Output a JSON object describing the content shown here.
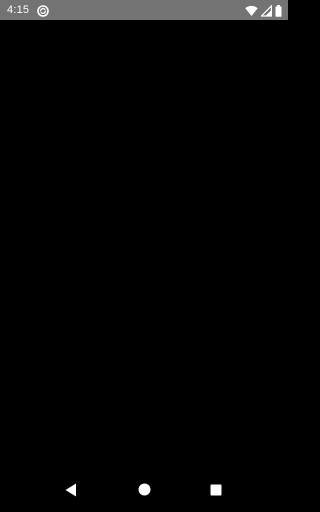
{
  "status_bar": {
    "time": "4:15",
    "background_color": "#737373",
    "app_icon": "sync-circle-icon",
    "right_icons": [
      "wifi-icon",
      "cellular-signal-icon",
      "battery-icon"
    ]
  },
  "content": {
    "background_color": "#000000"
  },
  "nav_bar": {
    "buttons": [
      "back-icon",
      "home-icon",
      "recents-icon"
    ]
  }
}
